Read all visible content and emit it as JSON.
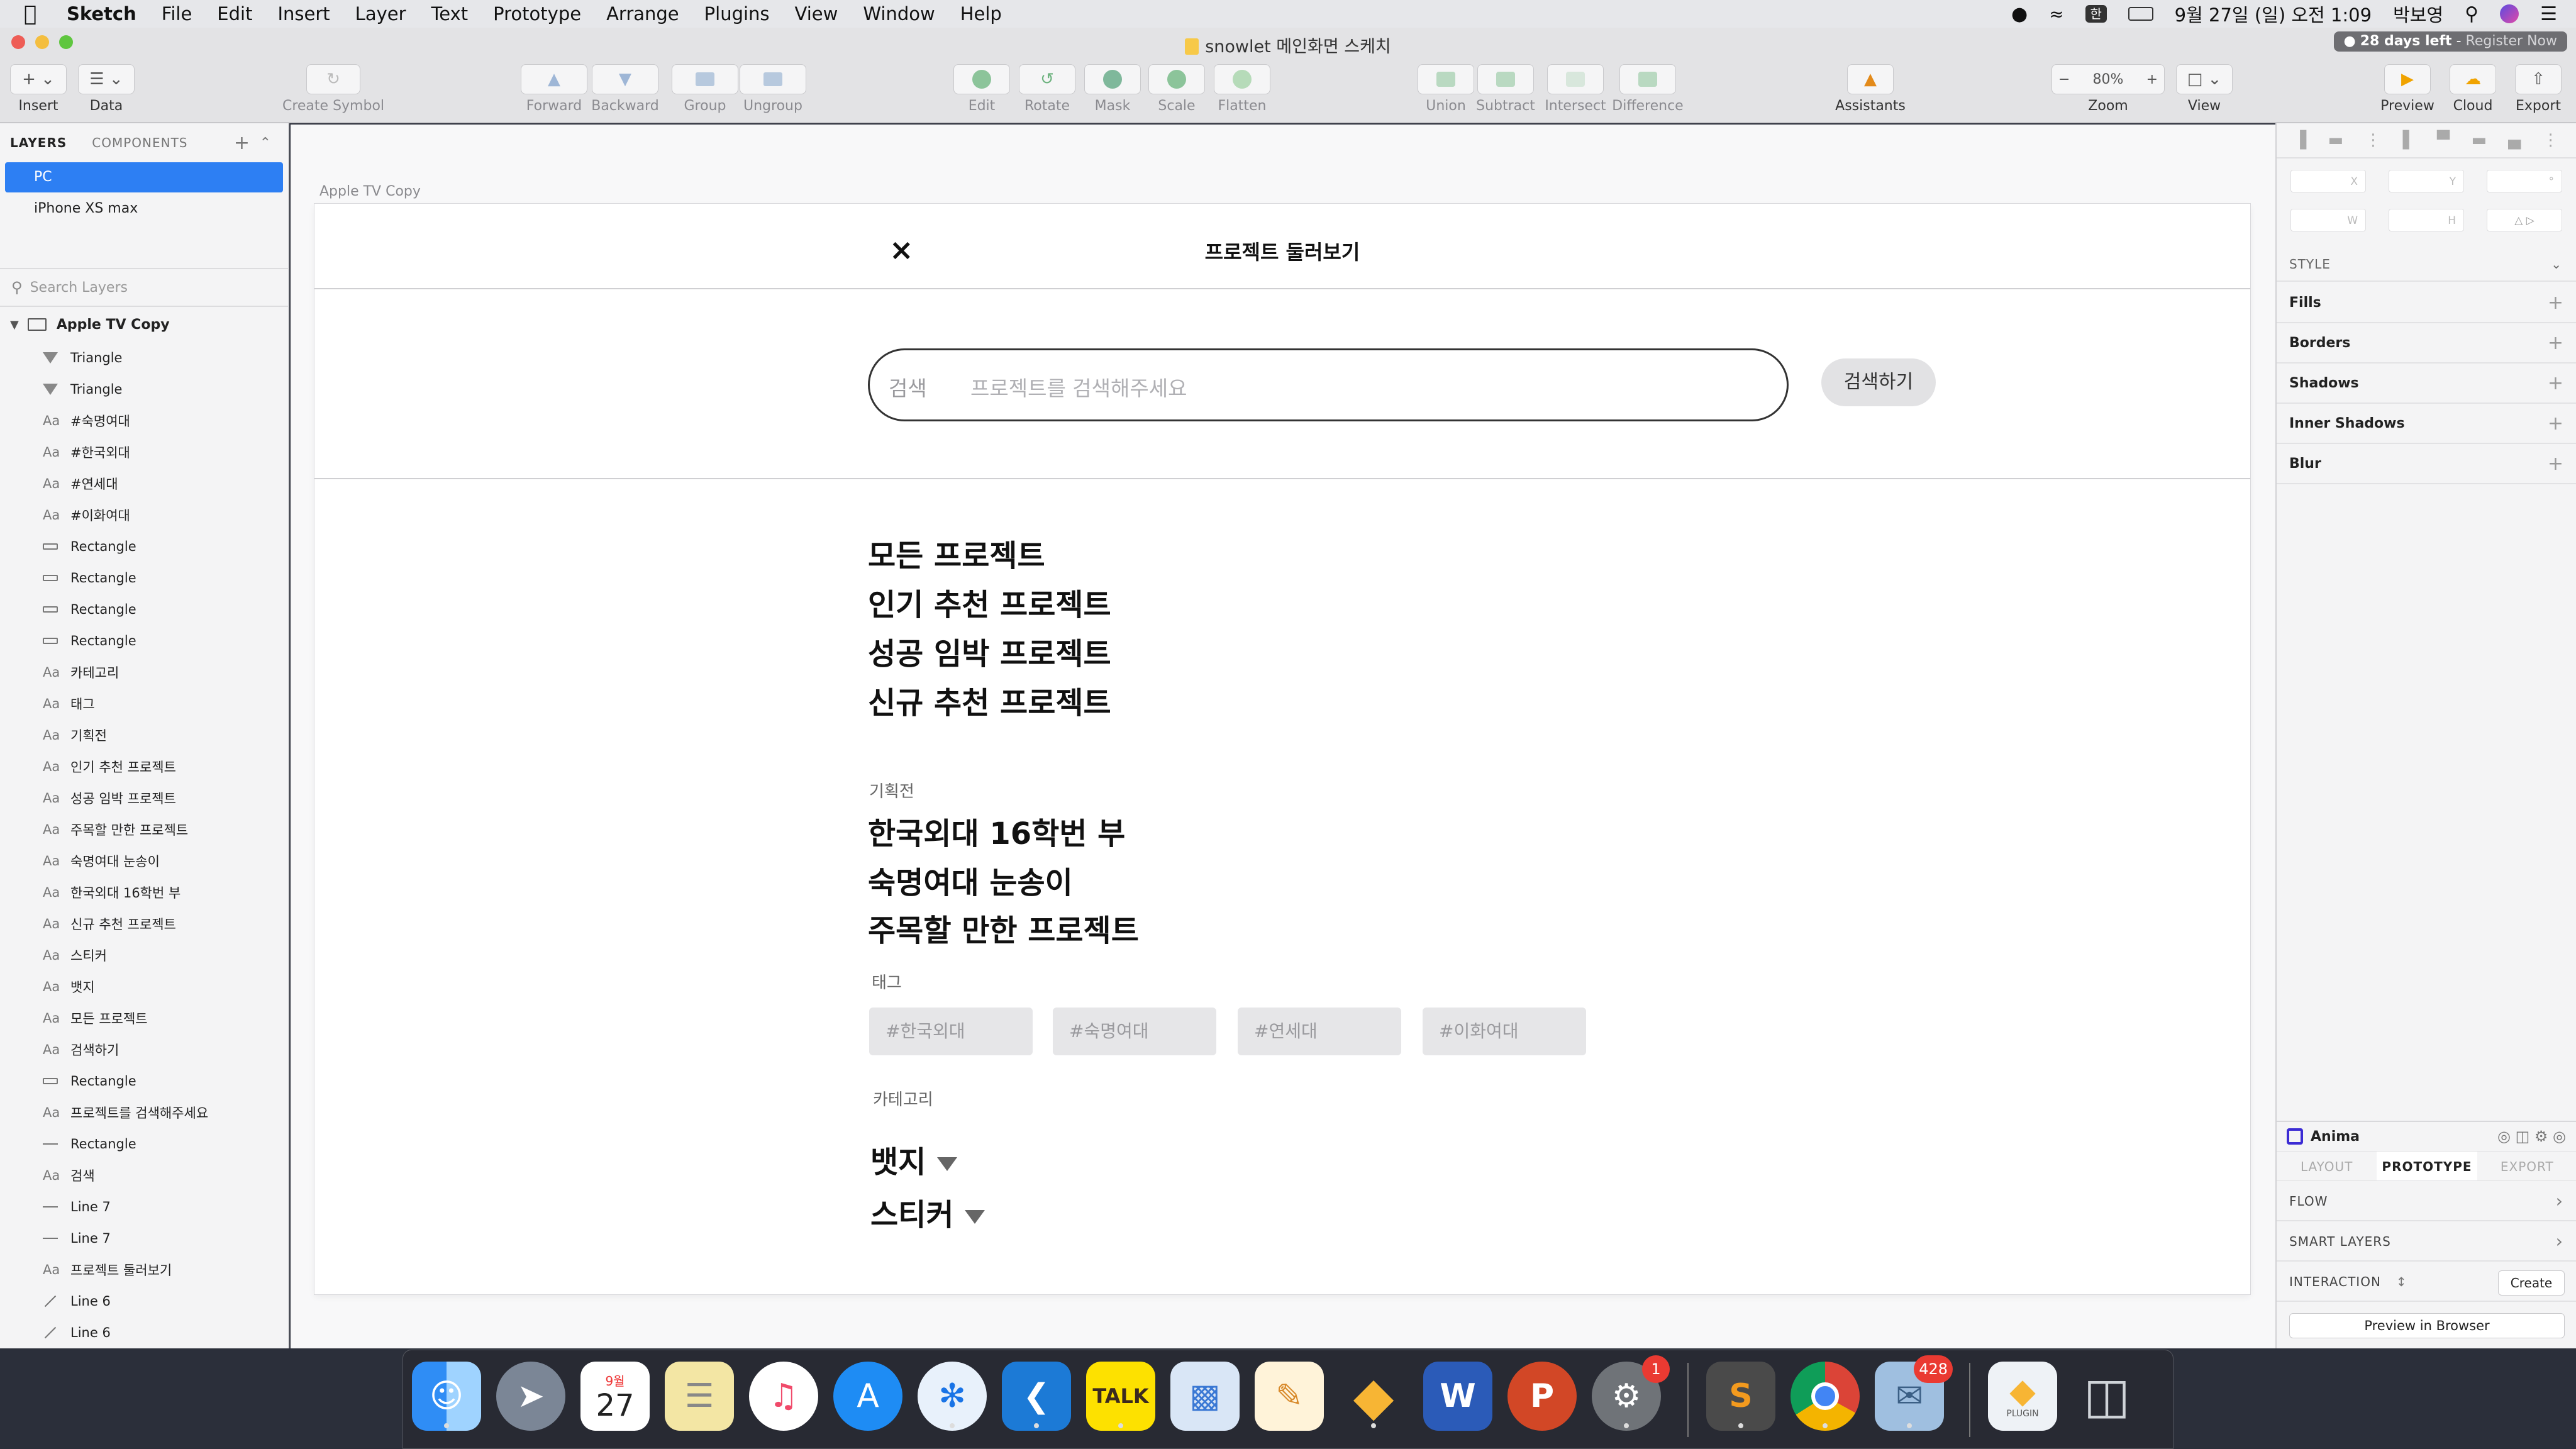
{
  "menubar": {
    "app": "Sketch",
    "items": [
      "File",
      "Edit",
      "Insert",
      "Layer",
      "Text",
      "Prototype",
      "Arrange",
      "Plugins",
      "View",
      "Window",
      "Help"
    ],
    "input_source": "한",
    "datetime": "9월 27일 (일) 오전 1:09",
    "user": "박보영"
  },
  "window": {
    "title": "snowlet 메인화면 스케치",
    "trial_days": "28 days left",
    "trial_register": "Register Now"
  },
  "toolbar": {
    "insert": "Insert",
    "data": "Data",
    "create_symbol": "Create Symbol",
    "forward": "Forward",
    "backward": "Backward",
    "group": "Group",
    "ungroup": "Ungroup",
    "edit": "Edit",
    "rotate": "Rotate",
    "mask": "Mask",
    "scale": "Scale",
    "flatten": "Flatten",
    "union": "Union",
    "subtract": "Subtract",
    "intersect": "Intersect",
    "difference": "Difference",
    "assistants": "Assistants",
    "zoom_value": "80%",
    "zoom": "Zoom",
    "view": "View",
    "preview": "Preview",
    "cloud": "Cloud",
    "export": "Export"
  },
  "left_panel": {
    "tab_layers": "LAYERS",
    "tab_components": "COMPONENTS",
    "pages": [
      "PC",
      "iPhone XS max"
    ],
    "search_placeholder": "Search Layers",
    "artboard": "Apple TV Copy",
    "layers": [
      {
        "type": "triangle",
        "name": "Triangle"
      },
      {
        "type": "triangle",
        "name": "Triangle"
      },
      {
        "type": "text",
        "name": "#숙명여대"
      },
      {
        "type": "text",
        "name": "#한국외대"
      },
      {
        "type": "text",
        "name": "#연세대"
      },
      {
        "type": "text",
        "name": "#이화여대"
      },
      {
        "type": "rect",
        "name": "Rectangle"
      },
      {
        "type": "rect",
        "name": "Rectangle"
      },
      {
        "type": "rect",
        "name": "Rectangle"
      },
      {
        "type": "rect",
        "name": "Rectangle"
      },
      {
        "type": "text",
        "name": "카테고리"
      },
      {
        "type": "text",
        "name": "태그"
      },
      {
        "type": "text",
        "name": "기획전"
      },
      {
        "type": "text",
        "name": "인기 추천 프로젝트"
      },
      {
        "type": "text",
        "name": "성공 임박 프로젝트"
      },
      {
        "type": "text",
        "name": "주목할 만한 프로젝트"
      },
      {
        "type": "text",
        "name": "숙명여대 눈송이"
      },
      {
        "type": "text",
        "name": "한국외대 16학번 부"
      },
      {
        "type": "text",
        "name": "신규 추천 프로젝트"
      },
      {
        "type": "text",
        "name": "스티커"
      },
      {
        "type": "text",
        "name": "뱃지"
      },
      {
        "type": "text",
        "name": "모든 프로젝트"
      },
      {
        "type": "text",
        "name": "검색하기"
      },
      {
        "type": "rect",
        "name": "Rectangle"
      },
      {
        "type": "text",
        "name": "프로젝트를 검색해주세요"
      },
      {
        "type": "line",
        "name": "Rectangle"
      },
      {
        "type": "text",
        "name": "검색"
      },
      {
        "type": "line",
        "name": "Line 7"
      },
      {
        "type": "line",
        "name": "Line 7"
      },
      {
        "type": "text",
        "name": "프로젝트 둘러보기"
      },
      {
        "type": "diag",
        "name": "Line 6"
      },
      {
        "type": "diag",
        "name": "Line 6"
      }
    ]
  },
  "canvas": {
    "artboard_label": "Apple TV Copy",
    "close_glyph": "×",
    "heading": "프로젝트 둘러보기",
    "search_label": "검색",
    "search_placeholder": "프로젝트를 검색해주세요",
    "search_button": "검색하기",
    "main_links": [
      "모든 프로젝트",
      "인기 추천 프로젝트",
      "성공 임박 프로젝트",
      "신규 추천 프로젝트"
    ],
    "exhibition_label": "기획전",
    "exhibitions": [
      "한국외대 16학번 부",
      "숙명여대 눈송이",
      "주목할 만한 프로젝트"
    ],
    "tag_label": "태그",
    "tags": [
      "#한국외대",
      "#숙명여대",
      "#연세대",
      "#이화여대"
    ],
    "category_label": "카테고리",
    "categories": [
      "뱃지",
      "스티커"
    ]
  },
  "inspector": {
    "style": "STYLE",
    "fills": "Fills",
    "borders": "Borders",
    "shadows": "Shadows",
    "inner_shadows": "Inner Shadows",
    "blur": "Blur",
    "fld_x": "X",
    "fld_y": "Y",
    "fld_w": "W",
    "fld_h": "H",
    "anima": "Anima",
    "tab_layout": "LAYOUT",
    "tab_prototype": "PROTOTYPE",
    "tab_export": "EXPORT",
    "flow": "FLOW",
    "smart_layers": "SMART LAYERS",
    "interaction": "INTERACTION",
    "create": "Create",
    "preview_browser": "Preview in Browser"
  },
  "dock": {
    "calendar_month": "9월",
    "calendar_day": "27",
    "talk": "TALK",
    "plugin": "PLUGIN",
    "prefs_badge": "1",
    "mail_badge": "428"
  },
  "colors": {
    "accent": "#2d7ff3",
    "tag_bg": "#e6e6e8",
    "canvas_bg": "#f8f8f9"
  }
}
